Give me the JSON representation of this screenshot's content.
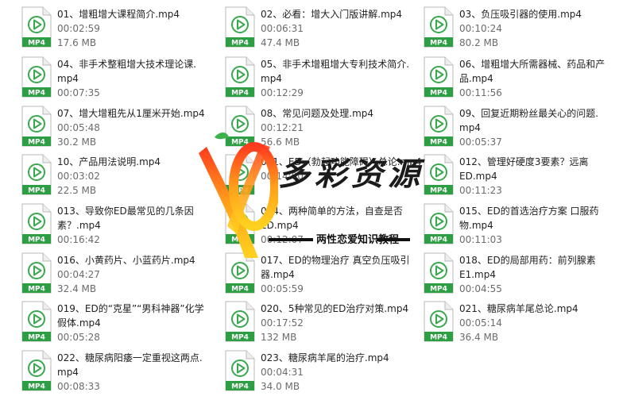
{
  "files": [
    {
      "name1": "01、增粗增大课程简介.mp4",
      "name2": "",
      "duration": "00:02:59",
      "size": "17.6 MB",
      "badge": "MP4"
    },
    {
      "name1": "02、必看：增大入门版讲解.mp4",
      "name2": "",
      "duration": "00:06:31",
      "size": "47.4 MB",
      "badge": "MP4"
    },
    {
      "name1": "03、负压吸引器的使用.mp4",
      "name2": "",
      "duration": "00:10:24",
      "size": "80.2 MB",
      "badge": "MP4"
    },
    {
      "name1": "04、非手术整粗增大技术理论课.",
      "name2": "mp4",
      "duration": "00:07:35",
      "size": "",
      "badge": "MP4"
    },
    {
      "name1": "05、非手术增粗增大专利技术简介.",
      "name2": "mp4",
      "duration": "00:12:29",
      "size": "",
      "badge": "MP4"
    },
    {
      "name1": "06、增粗增大所需器械、药品和产",
      "name2": "品.mp4",
      "duration": "00:11:56",
      "size": "",
      "badge": "MP4"
    },
    {
      "name1": "07、增大增粗先从1厘米开始.mp4",
      "name2": "",
      "duration": "00:05:48",
      "size": "30.2 MB",
      "badge": "MP4"
    },
    {
      "name1": "08、常见问题及处理.mp4",
      "name2": "",
      "duration": "00:12:21",
      "size": "56.6 MB",
      "badge": "MP4"
    },
    {
      "name1": "09、回复近期粉丝最关心的问题.",
      "name2": "mp4",
      "duration": "00:05:37",
      "size": "",
      "badge": "MP4"
    },
    {
      "name1": "10、产品用法说明.mp4",
      "name2": "",
      "duration": "00:03:02",
      "size": "22.5 MB",
      "badge": "MP4"
    },
    {
      "name1": "011、ED（勃起功能障碍）总论.mp4",
      "name2": "",
      "duration": "00:14:00",
      "size": "",
      "badge": "MP4"
    },
    {
      "name1": "012、管理好硬度3要素？远离",
      "name2": "ED.mp4",
      "duration": "00:11:23",
      "size": "",
      "badge": "MP4"
    },
    {
      "name1": "013、导致你ED最常见的几条因",
      "name2": "素？.mp4",
      "duration": "00:16:42",
      "size": "",
      "badge": "MP4"
    },
    {
      "name1": "014、两种简单的方法，自查是否",
      "name2": "ED.mp4",
      "duration": "00:12:07",
      "size": "",
      "badge": "MP4"
    },
    {
      "name1": "015、ED的首选治疗方案 口服药",
      "name2": "物.mp4",
      "duration": "00:11:03",
      "size": "",
      "badge": "MP4"
    },
    {
      "name1": "016、小黄药片、小蓝药片.mp4",
      "name2": "",
      "duration": "00:04:27",
      "size": "32.4 MB",
      "badge": "MP4"
    },
    {
      "name1": "017、ED的物理治疗 真空负压吸引",
      "name2": "器.mp4",
      "duration": "00:05:59",
      "size": "",
      "badge": "MP4"
    },
    {
      "name1": "018、ED的局部用药：前列腺素",
      "name2": "E1.mp4",
      "duration": "00:04:55",
      "size": "",
      "badge": "MP4"
    },
    {
      "name1": "019、ED的“克星”“男科神器”化学",
      "name2": "假体.mp4",
      "duration": "00:05:28",
      "size": "",
      "badge": "MP4"
    },
    {
      "name1": "020、5种常见的ED治疗对策.mp4",
      "name2": "",
      "duration": "00:17:52",
      "size": "132 MB",
      "badge": "MP4"
    },
    {
      "name1": "021、糖尿病羊尾总论.mp4",
      "name2": "",
      "duration": "00:05:14",
      "size": "36.4 MB",
      "badge": "MP4"
    },
    {
      "name1": "022、糖尿病阳痿一定重视这两点.",
      "name2": "mp4",
      "duration": "00:08:33",
      "size": "",
      "badge": "MP4"
    },
    {
      "name1": "023、糖尿病羊尾的治疗.mp4",
      "name2": "",
      "duration": "00:04:31",
      "size": "34.0 MB",
      "badge": "MP4"
    }
  ],
  "watermark": {
    "title": "多彩资源",
    "subtitle": "两性恋爱知识教程"
  },
  "colors": {
    "icon_green": "#2e9e45",
    "icon_stroke": "#3aa84f",
    "text": "#222222",
    "meta": "#6b6b6b"
  }
}
